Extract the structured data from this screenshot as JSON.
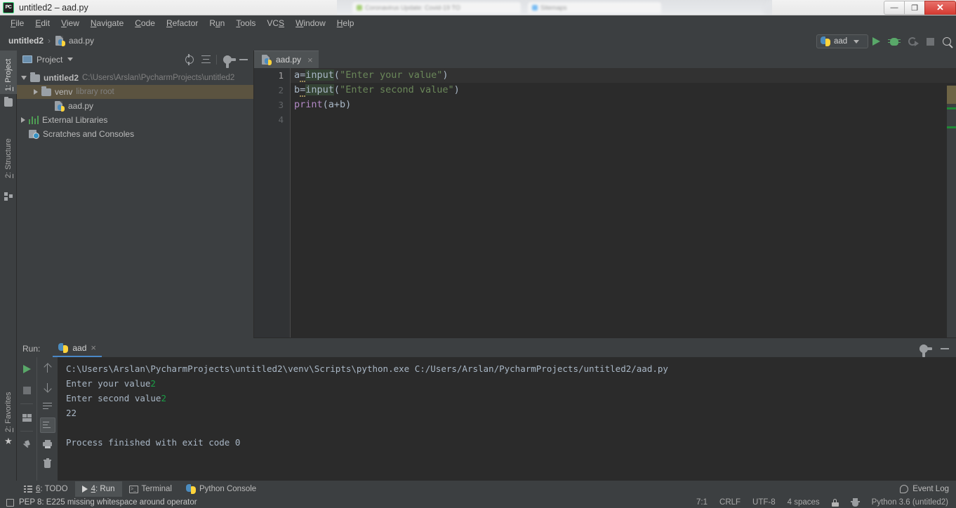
{
  "window": {
    "title": "untitled2 – aad.py",
    "app_icon": "pycharm-logo",
    "controls": {
      "minimize": "—",
      "maximize": "❐",
      "close": "✕"
    },
    "background_tabs": [
      {
        "label": "Coronavirus Update: Covid-19 TO"
      },
      {
        "label": "Sitemaps"
      }
    ]
  },
  "menu": {
    "items": [
      {
        "pre": "",
        "mn": "F",
        "post": "ile"
      },
      {
        "pre": "",
        "mn": "E",
        "post": "dit"
      },
      {
        "pre": "",
        "mn": "V",
        "post": "iew"
      },
      {
        "pre": "",
        "mn": "N",
        "post": "avigate"
      },
      {
        "pre": "",
        "mn": "C",
        "post": "ode"
      },
      {
        "pre": "",
        "mn": "R",
        "post": "efactor"
      },
      {
        "pre": "R",
        "mn": "u",
        "post": "n"
      },
      {
        "pre": "",
        "mn": "T",
        "post": "ools"
      },
      {
        "pre": "VC",
        "mn": "S",
        "post": ""
      },
      {
        "pre": "",
        "mn": "W",
        "post": "indow"
      },
      {
        "pre": "",
        "mn": "H",
        "post": "elp"
      }
    ]
  },
  "navbar": {
    "breadcrumb": [
      {
        "label": "untitled2",
        "icon": null
      },
      {
        "label": "aad.py",
        "icon": "python-file-icon"
      }
    ],
    "separator": "›",
    "run_config": {
      "name": "aad",
      "icon": "python-icon"
    },
    "buttons": [
      {
        "name": "run",
        "icon": "play-icon"
      },
      {
        "name": "debug",
        "icon": "bug-icon"
      },
      {
        "name": "run-with-coverage",
        "icon": "coverage-icon"
      },
      {
        "name": "stop",
        "icon": "stop-icon"
      },
      {
        "name": "search-everywhere",
        "icon": "search-icon"
      }
    ]
  },
  "left_stripe": {
    "tabs": [
      {
        "pre": "",
        "mn": "1",
        "post": ": Project",
        "active": true,
        "icon": "folder-icon"
      },
      {
        "pre": "",
        "mn": "2",
        "post": ": Structure",
        "active": false,
        "icon": "structure-icon"
      }
    ],
    "bottom_tab": {
      "pre": "",
      "mn": "2",
      "post": ": Favorites",
      "icon": "star-icon"
    }
  },
  "project_panel": {
    "title": "Project",
    "header_buttons": [
      {
        "name": "select-opened-file",
        "icon": "target-icon"
      },
      {
        "name": "collapse-all",
        "icon": "collapse-all-icon"
      },
      {
        "name": "settings",
        "icon": "gear-icon"
      },
      {
        "name": "hide",
        "icon": "minimize-icon"
      }
    ],
    "tree": [
      {
        "label": "untitled2",
        "secondary": "C:\\Users\\Arslan\\PycharmProjects\\untitled2",
        "icon": "folder-icon",
        "expanded": true,
        "bold": true,
        "indent": 0,
        "selected": false,
        "arrow": "down"
      },
      {
        "label": "venv",
        "secondary": "library root",
        "icon": "folder-icon",
        "expanded": false,
        "bold": false,
        "indent": 1,
        "selected": true,
        "arrow": "right"
      },
      {
        "label": "aad.py",
        "secondary": "",
        "icon": "python-file-icon",
        "expanded": false,
        "bold": false,
        "indent": 2,
        "selected": false,
        "arrow": "none"
      },
      {
        "label": "External Libraries",
        "secondary": "",
        "icon": "libraries-icon",
        "expanded": false,
        "bold": false,
        "indent": 0,
        "selected": false,
        "arrow": "right"
      },
      {
        "label": "Scratches and Consoles",
        "secondary": "",
        "icon": "scratches-icon",
        "expanded": false,
        "bold": false,
        "indent": 0,
        "selected": false,
        "arrow": "none"
      }
    ]
  },
  "editor": {
    "tab": {
      "label": "aad.py",
      "icon": "python-file-icon",
      "close": "×"
    },
    "line_numbers": [
      "1",
      "2",
      "3",
      "4"
    ],
    "current_line": 1,
    "lines": [
      {
        "n": "1",
        "tokens": [
          {
            "t": "a",
            "c": "var"
          },
          {
            "t": "=",
            "c": "punct-warn"
          },
          {
            "t": "input",
            "c": "fn"
          },
          {
            "t": "(",
            "c": "punct"
          },
          {
            "t": "\"Enter your value\"",
            "c": "str"
          },
          {
            "t": ")",
            "c": "punct"
          }
        ]
      },
      {
        "n": "2",
        "tokens": [
          {
            "t": "b",
            "c": "var"
          },
          {
            "t": "=",
            "c": "punct-warn"
          },
          {
            "t": "input",
            "c": "fn"
          },
          {
            "t": "(",
            "c": "punct"
          },
          {
            "t": "\"Enter second value\"",
            "c": "str"
          },
          {
            "t": ")",
            "c": "punct"
          }
        ]
      },
      {
        "n": "3",
        "tokens": [
          {
            "t": "print",
            "c": "builtin"
          },
          {
            "t": "(",
            "c": "punct"
          },
          {
            "t": "a+b",
            "c": "var"
          },
          {
            "t": ")",
            "c": "punct"
          }
        ]
      },
      {
        "n": "4",
        "tokens": []
      }
    ]
  },
  "run_panel": {
    "label": "Run:",
    "tab": {
      "label": "aad",
      "icon": "python-icon",
      "close": "×"
    },
    "header_buttons": [
      {
        "name": "settings",
        "icon": "gear-icon"
      },
      {
        "name": "hide",
        "icon": "minimize-icon"
      }
    ],
    "left_toolbar": [
      {
        "name": "rerun",
        "icon": "play-icon"
      },
      {
        "name": "stop",
        "icon": "stop-icon"
      },
      {
        "name": "layout",
        "icon": "layout-icon"
      },
      {
        "name": "pin-tab",
        "icon": "pin-icon"
      }
    ],
    "console_toolbar": [
      {
        "name": "up-the-stack-trace",
        "icon": "arrow-up-icon",
        "active": false
      },
      {
        "name": "down-the-stack-trace",
        "icon": "arrow-down-icon",
        "active": false
      },
      {
        "name": "soft-wrap",
        "icon": "soft-wrap-icon",
        "active": false
      },
      {
        "name": "scroll-to-end",
        "icon": "scroll-to-end-icon",
        "active": true
      },
      {
        "name": "print",
        "icon": "print-icon",
        "active": false
      },
      {
        "name": "clear-all",
        "icon": "trash-icon",
        "active": false
      }
    ],
    "console": [
      {
        "text": "C:\\Users\\Arslan\\PycharmProjects\\untitled2\\venv\\Scripts\\python.exe C:/Users/Arslan/PycharmProjects/untitled2/aad.py",
        "input": ""
      },
      {
        "text": "Enter your value",
        "input": "2"
      },
      {
        "text": "Enter second value",
        "input": "2"
      },
      {
        "text": "22",
        "input": ""
      },
      {
        "text": "",
        "input": ""
      },
      {
        "text": "Process finished with exit code 0",
        "input": ""
      }
    ]
  },
  "bottom_bar": {
    "tools": [
      {
        "pre": "",
        "mn": "6",
        "post": ": TODO",
        "icon": "todo-icon",
        "active": false
      },
      {
        "pre": "",
        "mn": "4",
        "post": ": Run",
        "icon": "play-icon",
        "active": true
      },
      {
        "pre": "Terminal",
        "mn": "",
        "post": "",
        "icon": "terminal-icon",
        "active": false
      },
      {
        "pre": "Python Console",
        "mn": "",
        "post": "",
        "icon": "python-icon",
        "active": false
      }
    ],
    "event_log": {
      "label": "Event Log",
      "icon": "event-log-icon"
    }
  },
  "status_bar": {
    "message": "PEP 8: E225 missing whitespace around operator",
    "message_icon": "inspection-icon",
    "caret": "7:1",
    "line_separator": "CRLF",
    "encoding": "UTF-8",
    "indent": "4 spaces",
    "lock_icon": "lock-icon",
    "hector_icon": "hector-icon",
    "interpreter": "Python 3.6 (untitled2)"
  },
  "colors": {
    "bg_panel": "#3c3f41",
    "bg_editor": "#2b2b2b",
    "accent_blue": "#4a88c7",
    "green_run": "#59a869",
    "string_green": "#6a8759",
    "builtin_purple": "#b389c6",
    "selection_tan": "#5b5340",
    "input_green": "#1a9e46"
  }
}
